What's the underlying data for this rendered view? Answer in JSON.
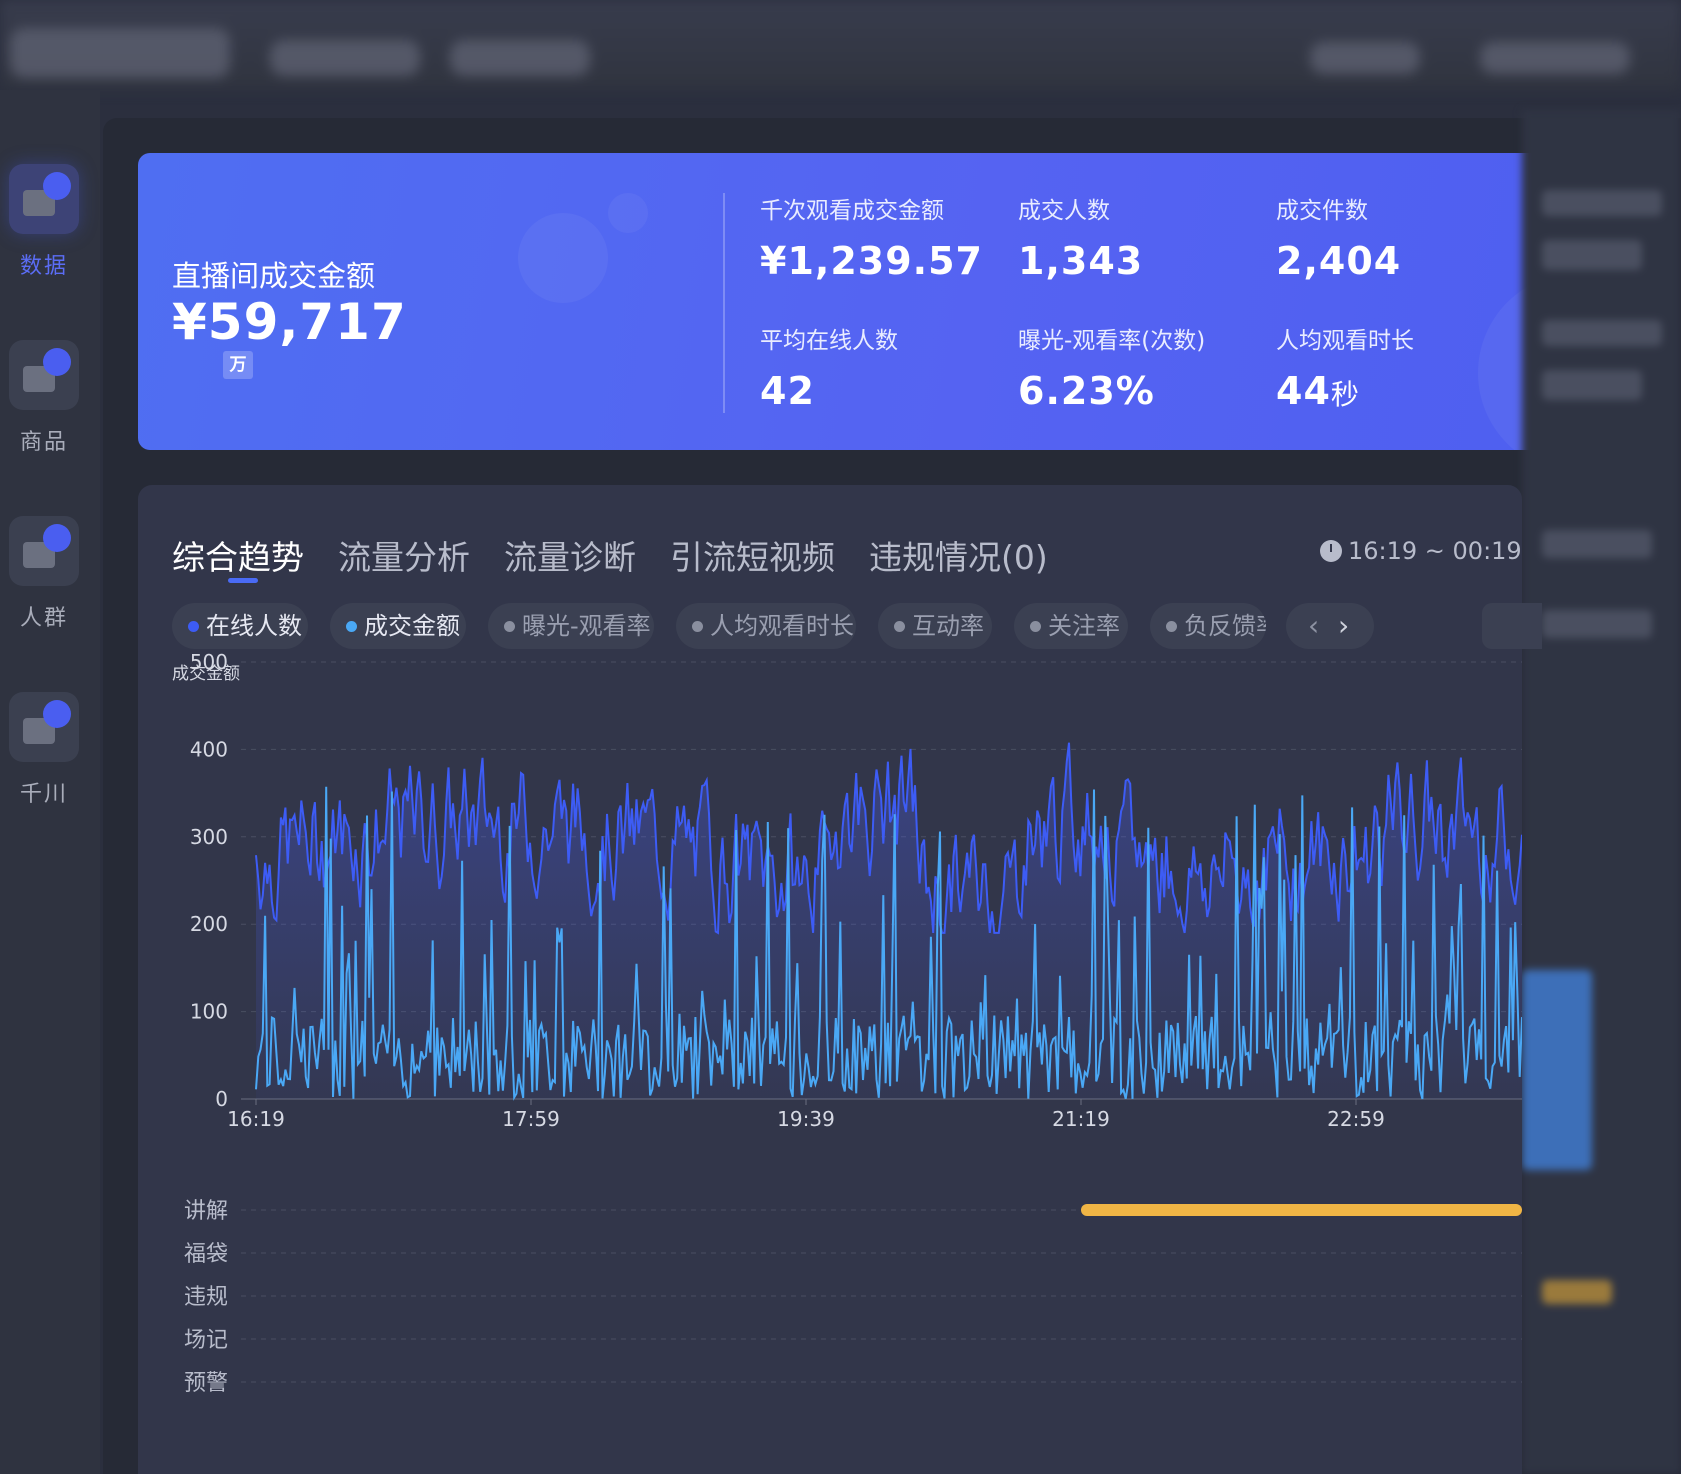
{
  "sidebar": {
    "items": [
      {
        "label": "数据",
        "icon": "chart-icon",
        "active": true
      },
      {
        "label": "商品",
        "icon": "cart-icon",
        "active": false
      },
      {
        "label": "人群",
        "icon": "user-group-icon",
        "active": false
      },
      {
        "label": "千川",
        "icon": "ads-icon",
        "active": false
      }
    ]
  },
  "hero": {
    "title": "直播间成交金额",
    "value": "¥59,717",
    "unit": "万",
    "metrics": [
      {
        "label": "千次观看成交金额",
        "value": "¥1,239.57"
      },
      {
        "label": "成交人数",
        "value": "1,343"
      },
      {
        "label": "成交件数",
        "value": "2,404"
      },
      {
        "label": "平均在线人数",
        "value": "42"
      },
      {
        "label": "曝光-观看率(次数)",
        "value": "6.23%"
      },
      {
        "label": "人均观看时长",
        "value": "44",
        "unit": "秒"
      }
    ]
  },
  "tabs": [
    "综合趋势",
    "流量分析",
    "流量诊断",
    "引流短视频",
    "违规情况(0)"
  ],
  "time_range": "16:19 ~ 00:19",
  "pills": [
    {
      "label": "在线人数",
      "on": true,
      "color": "#3d5cf5"
    },
    {
      "label": "成交金额",
      "on": true,
      "color": "#4aa8f5"
    },
    {
      "label": "曝光-观看率",
      "on": false
    },
    {
      "label": "人均观看时长",
      "on": false
    },
    {
      "label": "互动率",
      "on": false
    },
    {
      "label": "关注率",
      "on": false
    },
    {
      "label": "负反馈率",
      "on": false
    }
  ],
  "chart_data": {
    "type": "line",
    "ylabel": "成交金额",
    "ylim": [
      0,
      500
    ],
    "yticks": [
      0,
      100,
      200,
      300,
      400,
      500
    ],
    "xticks": [
      "16:19",
      "17:59",
      "19:39",
      "21:19",
      "22:59"
    ],
    "series": [
      {
        "name": "在线人数",
        "color": "#3d5cf5",
        "summary": {
          "min": 190,
          "max": 485,
          "typical": 280
        }
      },
      {
        "name": "成交金额",
        "color": "#4aa8f5",
        "summary": {
          "min": 0,
          "max": 360,
          "typical": 60
        }
      }
    ],
    "event_rows": [
      "讲解",
      "福袋",
      "违规",
      "场记",
      "预警"
    ],
    "event_bars": [
      {
        "row": "讲解",
        "start": "21:19",
        "end": "00:19",
        "color": "#f0b545"
      }
    ]
  },
  "colors": {
    "accent": "#4f6ef2",
    "panel": "#32364a",
    "background": "#262a36",
    "event": "#f0b545"
  }
}
